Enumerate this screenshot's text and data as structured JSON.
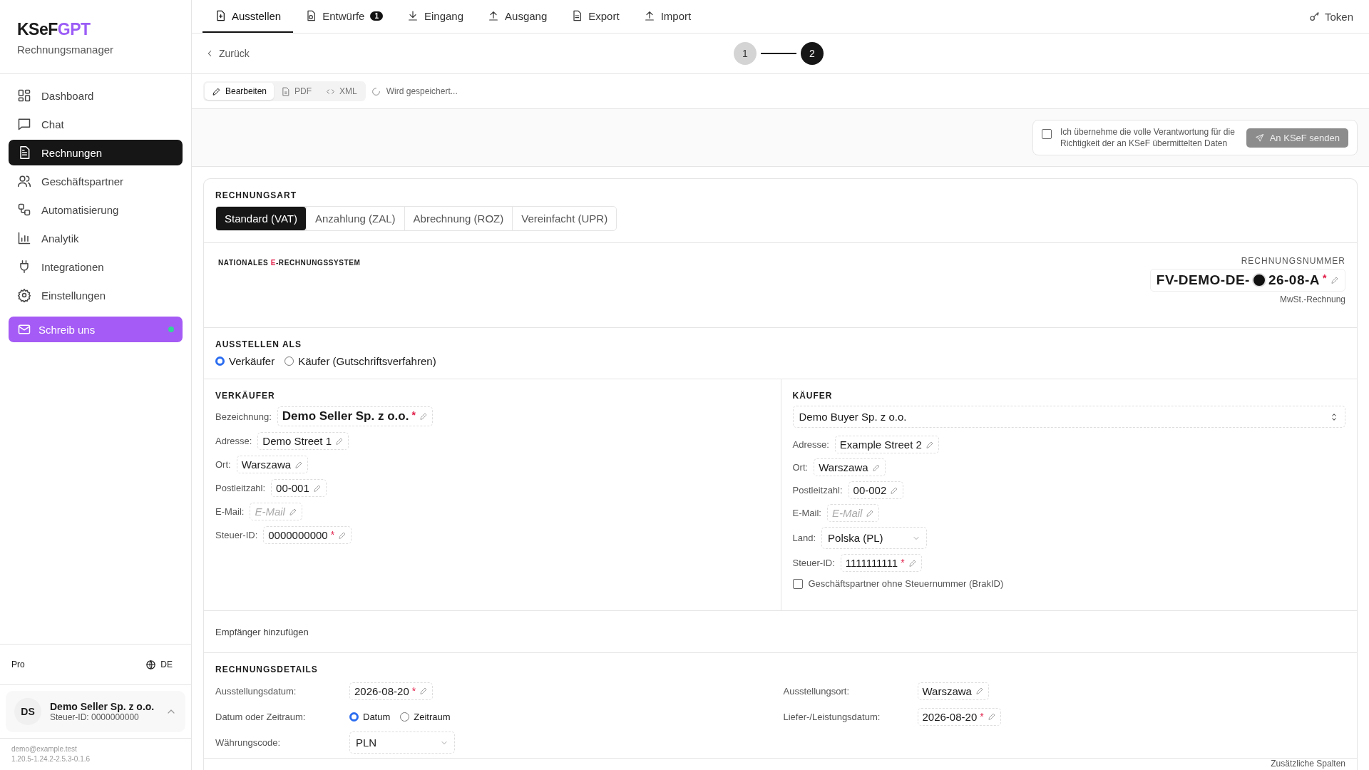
{
  "sidebar": {
    "logo_main": "KSeF",
    "logo_accent": "GPT",
    "subtitle": "Rechnungsmanager",
    "items": [
      {
        "label": "Dashboard",
        "selected": false
      },
      {
        "label": "Chat",
        "selected": false
      },
      {
        "label": "Rechnungen",
        "selected": true
      },
      {
        "label": "Geschäftspartner",
        "selected": false
      },
      {
        "label": "Automatisierung",
        "selected": false
      },
      {
        "label": "Analytik",
        "selected": false
      },
      {
        "label": "Integrationen",
        "selected": false
      },
      {
        "label": "Einstellungen",
        "selected": false
      }
    ],
    "contact": {
      "label": "Schreib uns",
      "online": true
    },
    "plan": "Pro",
    "language": "DE",
    "account": {
      "initials": "DS",
      "name": "Demo Seller Sp. z o.o.",
      "tax_id": "Steuer-ID: 0000000000"
    },
    "email": "demo@example.test",
    "version": "1.20.5-1.24.2-2.5.3-0.1.6"
  },
  "top_nav": {
    "tabs": [
      {
        "label": "Ausstellen",
        "selected": true
      },
      {
        "label": "Entwürfe",
        "selected": false,
        "badge": "1"
      },
      {
        "label": "Eingang",
        "selected": false
      },
      {
        "label": "Ausgang",
        "selected": false
      },
      {
        "label": "Export",
        "selected": false
      },
      {
        "label": "Import",
        "selected": false
      }
    ],
    "token": "Token"
  },
  "back": "Zurück",
  "steps": [
    {
      "label": "1",
      "selected": false
    },
    {
      "label": "2",
      "selected": true
    }
  ],
  "view_modes": [
    {
      "label": "Bearbeiten",
      "selected": true
    },
    {
      "label": "PDF",
      "selected": false
    },
    {
      "label": "XML",
      "selected": false
    }
  ],
  "save_status": "Wird gespeichert...",
  "confirm": {
    "checked": false,
    "text": "Ich übernehme die volle Verantwortung für die Richtigkeit der an KSeF übermittelten Daten",
    "button": "An KSeF senden",
    "disabled": true
  },
  "invoice_type": {
    "heading": "RECHNUNGSART",
    "options": [
      {
        "label": "Standard (VAT)",
        "selected": true
      },
      {
        "label": "Anzahlung (ZAL)",
        "selected": false
      },
      {
        "label": "Abrechnung (ROZ)",
        "selected": false
      },
      {
        "label": "Vereinfacht (UPR)",
        "selected": false
      }
    ]
  },
  "national": {
    "heading_before": "NATIONALES ",
    "heading_accent": "E",
    "heading_after": "-RECHNUNGSSYSTEM"
  },
  "invoice_number": {
    "label": "RECHNUNGSNUMMER",
    "value_before": "FV-DEMO-DE-",
    "value_after": "26-08-A",
    "required_mark": "*",
    "caption": "MwSt.-Rechnung"
  },
  "issue_as": {
    "heading": "AUSSTELLEN ALS",
    "options": [
      {
        "label": "Verkäufer",
        "selected": true
      },
      {
        "label": "Käufer (Gutschriftsverfahren)",
        "selected": false
      }
    ]
  },
  "seller": {
    "heading": "VERKÄUFER",
    "fields": [
      {
        "kind": "name",
        "label": "Bezeichnung:",
        "value": "Demo Seller Sp. z o.o.",
        "required_mark": "*"
      },
      {
        "label": "Adresse:",
        "value": "Demo Street 1"
      },
      {
        "label": "Ort:",
        "value": "Warszawa"
      },
      {
        "label": "Postleitzahl:",
        "value": "00-001"
      },
      {
        "label": "E-Mail:",
        "placeholder": "E-Mail"
      },
      {
        "label": "Steuer-ID:",
        "value": "0000000000",
        "required_mark": "*"
      }
    ]
  },
  "buyer": {
    "heading": "KÄUFER",
    "partner": "Demo Buyer Sp. z o.o.",
    "fields": [
      {
        "label": "Adresse:",
        "value": "Example Street 2"
      },
      {
        "label": "Ort:",
        "value": "Warszawa"
      },
      {
        "label": "Postleitzahl:",
        "value": "00-002"
      },
      {
        "label": "E-Mail:",
        "placeholder": "E-Mail"
      },
      {
        "kind": "select",
        "label": "Land:",
        "value": "Polska (PL)"
      },
      {
        "label": "Steuer-ID:",
        "value": "1111111111",
        "required_mark": "*"
      }
    ],
    "no_tax_id": {
      "label": "Geschäftspartner ohne Steuernummer (BrakID)",
      "checked": false
    }
  },
  "add_recipient": "Empfänger hinzufügen",
  "details": {
    "heading": "RECHNUNGSDETAILS",
    "left": [
      {
        "label": "Ausstellungsdatum:",
        "value": "2026-08-20",
        "required_mark": "*"
      },
      {
        "kind": "radio",
        "label": "Datum oder Zeitraum:",
        "options": [
          {
            "label": "Datum",
            "selected": true
          },
          {
            "label": "Zeitraum",
            "selected": false
          }
        ]
      },
      {
        "kind": "select",
        "label": "Währungscode:",
        "value": "PLN"
      }
    ],
    "right": [
      {
        "label": "Ausstellungsort:",
        "value": "Warszawa"
      },
      {
        "label": "Liefer-/Leistungsdatum:",
        "value": "2026-08-20",
        "required_mark": "*"
      }
    ]
  },
  "extra_columns": "Zusätzliche Spalten"
}
